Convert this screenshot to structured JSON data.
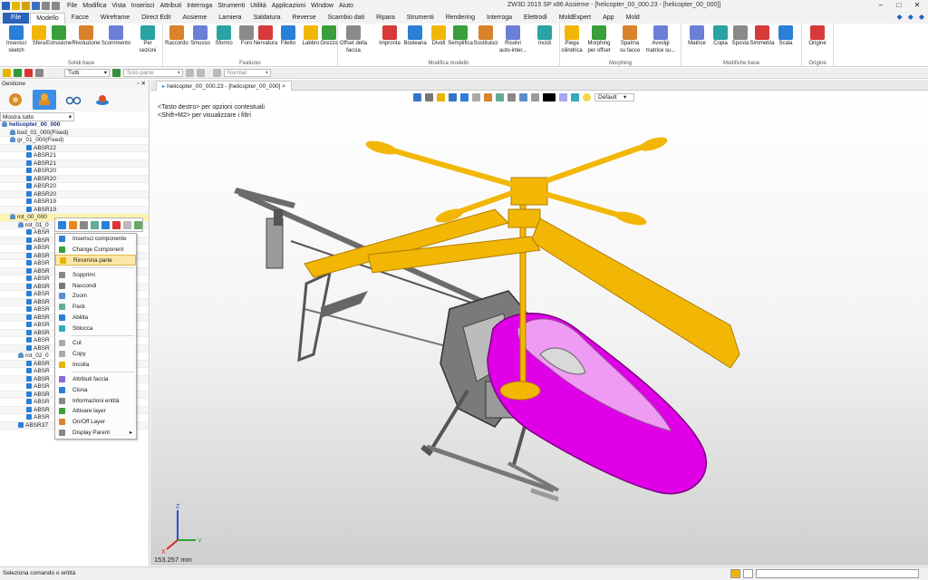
{
  "window": {
    "title": "ZW3D 2015 SP x86      Assieme - [helicopter_00_000.23 - [helicopter_00_000]]"
  },
  "menubar": [
    "File",
    "Modifica",
    "Vista",
    "Inserisci",
    "Attributi",
    "Interroga",
    "Strumenti",
    "Utilità",
    "Applicazioni",
    "Window",
    "Aiuto"
  ],
  "ribbon_tabs": [
    "File",
    "Modello",
    "Facce",
    "Wireframe",
    "Direct Edit",
    "Assieme",
    "Lamiera",
    "Saldatura",
    "Reverse",
    "Scambio dati",
    "Ripara",
    "Strumenti",
    "Rendering",
    "Interroga",
    "Elettrodi",
    "MoldExpert",
    "App",
    "Mold"
  ],
  "ribbon_groups": [
    {
      "title": "Solidi base",
      "buttons": [
        {
          "l1": "Inserisci",
          "l2": "sketch"
        },
        {
          "l1": "Sfera",
          "l2": ""
        },
        {
          "l1": "Estrusione",
          "l2": ""
        },
        {
          "l1": "Rivoluzione",
          "l2": ""
        },
        {
          "l1": "Scorrimento",
          "l2": ""
        },
        {
          "l1": "Per",
          "l2": "sezioni"
        }
      ]
    },
    {
      "title": "Features",
      "buttons": [
        {
          "l1": "Raccordo",
          "l2": ""
        },
        {
          "l1": "Smusso",
          "l2": ""
        },
        {
          "l1": "Sformo",
          "l2": ""
        },
        {
          "l1": "Foro",
          "l2": ""
        },
        {
          "l1": "Nervatura",
          "l2": ""
        },
        {
          "l1": "Filetto",
          "l2": ""
        },
        {
          "l1": "Labbro",
          "l2": ""
        },
        {
          "l1": "Grezzo",
          "l2": ""
        }
      ]
    },
    {
      "title": "Modifica modello",
      "buttons": [
        {
          "l1": "Offset della",
          "l2": "faccia"
        },
        {
          "l1": "Impronta",
          "l2": ""
        },
        {
          "l1": "Booleana",
          "l2": ""
        },
        {
          "l1": "Dividi",
          "l2": ""
        },
        {
          "l1": "Semplifica",
          "l2": ""
        },
        {
          "l1": "Sostituisci",
          "l2": ""
        },
        {
          "l1": "Risolvi",
          "l2": "auto-inter..."
        },
        {
          "l1": "Incidi",
          "l2": ""
        }
      ]
    },
    {
      "title": "Morphing",
      "buttons": [
        {
          "l1": "Piega",
          "l2": "cilindrica"
        },
        {
          "l1": "Morphing",
          "l2": "per offset"
        },
        {
          "l1": "Spalma",
          "l2": "su facce"
        },
        {
          "l1": "Avvolgi",
          "l2": "matrice su..."
        }
      ]
    },
    {
      "title": "Modifiche base",
      "buttons": [
        {
          "l1": "Matrice",
          "l2": ""
        },
        {
          "l1": "Copia",
          "l2": ""
        },
        {
          "l1": "Sposta",
          "l2": ""
        },
        {
          "l1": "Simmetria",
          "l2": ""
        },
        {
          "l1": "Scala",
          "l2": ""
        }
      ]
    },
    {
      "title": "Origine",
      "buttons": [
        {
          "l1": "Origine",
          "l2": ""
        }
      ]
    }
  ],
  "toolbar2": {
    "filter_value": "Tutti",
    "part_value": "Solo parte",
    "mode_value": "Normal"
  },
  "left_panel": {
    "title": "Gestione",
    "filter": "Mostra tutto",
    "tree": [
      {
        "label": "helicopter_00_000",
        "indent": 0,
        "type": "root"
      },
      {
        "label": "bod_01_000(Fixed)",
        "indent": 1,
        "type": "assy"
      },
      {
        "label": "gr_01_000(Fixed)",
        "indent": 1,
        "type": "assy"
      },
      {
        "label": "ABSR22",
        "indent": 3,
        "type": "part"
      },
      {
        "label": "ABSR21",
        "indent": 3,
        "type": "part"
      },
      {
        "label": "ABSR21",
        "indent": 3,
        "type": "part"
      },
      {
        "label": "ABSR20",
        "indent": 3,
        "type": "part"
      },
      {
        "label": "ABSR20",
        "indent": 3,
        "type": "part"
      },
      {
        "label": "ABSR20",
        "indent": 3,
        "type": "part"
      },
      {
        "label": "ABSR20",
        "indent": 3,
        "type": "part"
      },
      {
        "label": "ABSR19",
        "indent": 3,
        "type": "part"
      },
      {
        "label": "ABSR19",
        "indent": 3,
        "type": "part"
      },
      {
        "label": "rot_00_000",
        "indent": 1,
        "type": "assy-sel"
      },
      {
        "label": "rot_01_0",
        "indent": 2,
        "type": "assy"
      },
      {
        "label": "ABSR",
        "indent": 3,
        "type": "part"
      },
      {
        "label": "ABSR",
        "indent": 3,
        "type": "part"
      },
      {
        "label": "ABSR",
        "indent": 3,
        "type": "part"
      },
      {
        "label": "ABSR",
        "indent": 3,
        "type": "part"
      },
      {
        "label": "ABSR",
        "indent": 3,
        "type": "part"
      },
      {
        "label": "ABSR",
        "indent": 3,
        "type": "part"
      },
      {
        "label": "ABSR",
        "indent": 3,
        "type": "part"
      },
      {
        "label": "ABSR",
        "indent": 3,
        "type": "part"
      },
      {
        "label": "ABSR",
        "indent": 3,
        "type": "part"
      },
      {
        "label": "ABSR",
        "indent": 3,
        "type": "part"
      },
      {
        "label": "ABSR",
        "indent": 3,
        "type": "part"
      },
      {
        "label": "ABSR",
        "indent": 3,
        "type": "part"
      },
      {
        "label": "ABSR",
        "indent": 3,
        "type": "part"
      },
      {
        "label": "ABSR",
        "indent": 3,
        "type": "part"
      },
      {
        "label": "ABSR",
        "indent": 3,
        "type": "part"
      },
      {
        "label": "ABSR",
        "indent": 3,
        "type": "part"
      },
      {
        "label": "rot_02_0",
        "indent": 2,
        "type": "assy"
      },
      {
        "label": "ABSR",
        "indent": 3,
        "type": "part"
      },
      {
        "label": "ABSR",
        "indent": 3,
        "type": "part"
      },
      {
        "label": "ABSR",
        "indent": 3,
        "type": "part"
      },
      {
        "label": "ABSR",
        "indent": 3,
        "type": "part"
      },
      {
        "label": "ABSR",
        "indent": 3,
        "type": "part"
      },
      {
        "label": "ABSR",
        "indent": 3,
        "type": "part"
      },
      {
        "label": "ABSR",
        "indent": 3,
        "type": "part"
      },
      {
        "label": "ABSR",
        "indent": 3,
        "type": "part"
      },
      {
        "label": "ABSR37",
        "indent": 2,
        "type": "part"
      }
    ]
  },
  "context_menu": [
    {
      "label": "Inserisci componente",
      "sep_after": false,
      "highlight": false
    },
    {
      "label": "Change Component",
      "sep_after": false,
      "highlight": false
    },
    {
      "label": "Rinomina parte",
      "sep_after": true,
      "highlight": true
    },
    {
      "label": "Sopprimi",
      "sep_after": false,
      "highlight": false
    },
    {
      "label": "Nascondi",
      "sep_after": false,
      "highlight": false
    },
    {
      "label": "Zoom",
      "sep_after": false,
      "highlight": false
    },
    {
      "label": "Pack",
      "sep_after": false,
      "highlight": false
    },
    {
      "label": "Abilita",
      "sep_after": false,
      "highlight": false
    },
    {
      "label": "Sblocca",
      "sep_after": true,
      "highlight": false
    },
    {
      "label": "Cut",
      "sep_after": false,
      "highlight": false
    },
    {
      "label": "Copy",
      "sep_after": false,
      "highlight": false
    },
    {
      "label": "Incolla",
      "sep_after": true,
      "highlight": false
    },
    {
      "label": "Attributi faccia",
      "sep_after": false,
      "highlight": false
    },
    {
      "label": "Clona",
      "sep_after": false,
      "highlight": false
    },
    {
      "label": "Informazioni entità",
      "sep_after": false,
      "highlight": false
    },
    {
      "label": "Attivare layer",
      "sep_after": false,
      "highlight": false
    },
    {
      "label": "On/Off Layer",
      "sep_after": false,
      "highlight": false
    },
    {
      "label": "Display Parent",
      "sep_after": false,
      "highlight": false,
      "submenu": "▸"
    }
  ],
  "document": {
    "tab_label": "helicopter_00_000.23 - [helicopter_00_000]",
    "close": "×"
  },
  "viewport": {
    "hint1": "<Tasto destro> per opzioni contestuali",
    "hint2": "<Shift+M2> per visualizzare i filtri",
    "style_dropdown": "Default",
    "scale_readout": "153.257 mm",
    "axis_x": "X",
    "axis_y": "Y",
    "axis_z": "Z"
  },
  "status": {
    "text": "Seleziona comando o entità"
  },
  "colors": {
    "accent": "#2a63b8",
    "rotor": "#f2b705",
    "canopy": "#e000e8",
    "frame": "#707070"
  }
}
